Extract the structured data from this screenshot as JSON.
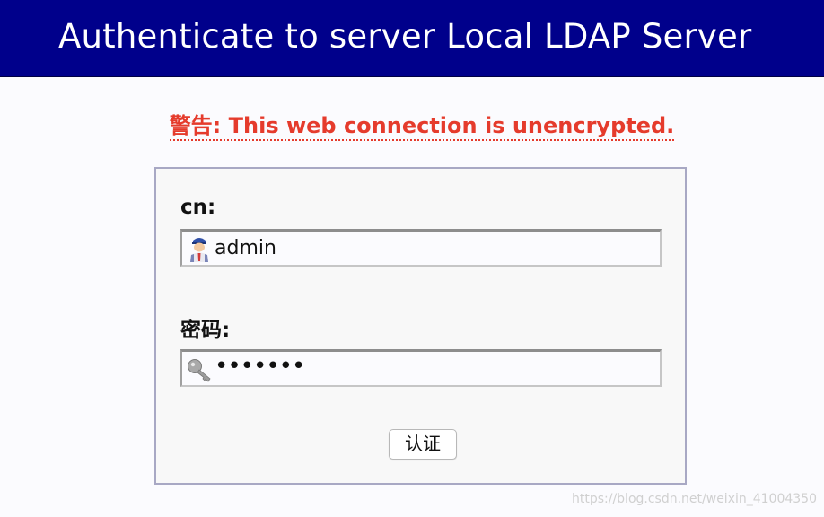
{
  "header": {
    "title": "Authenticate to server Local LDAP Server"
  },
  "warning": {
    "text": "警告: This web connection is unencrypted."
  },
  "form": {
    "cn_label": "cn:",
    "cn_value": "admin",
    "cn_icon": "user-icon",
    "password_label": "密码:",
    "password_value": "•••••••",
    "password_icon": "key-icon",
    "submit_label": "认证"
  },
  "watermark": {
    "text": "https://blog.csdn.net/weixin_41004350"
  }
}
